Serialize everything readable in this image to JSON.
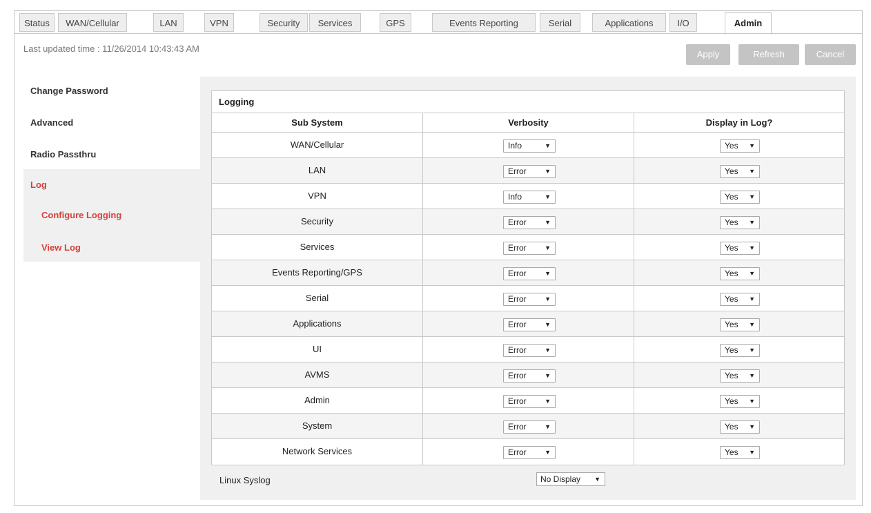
{
  "tabs": [
    "Status",
    "WAN/Cellular",
    "LAN",
    "VPN",
    "Security",
    "Services",
    "GPS",
    "Events Reporting",
    "Serial",
    "Applications",
    "I/O",
    "Admin"
  ],
  "active_tab": "Admin",
  "last_updated": "Last updated time : 11/26/2014 10:43:43 AM",
  "buttons": {
    "apply": "Apply",
    "refresh": "Refresh",
    "cancel": "Cancel"
  },
  "sidebar": {
    "change_password": "Change Password",
    "advanced": "Advanced",
    "radio_passthru": "Radio Passthru",
    "log": "Log",
    "configure_logging": "Configure Logging",
    "view_log": "View Log"
  },
  "logging": {
    "caption": "Logging",
    "headers": {
      "sub_system": "Sub System",
      "verbosity": "Verbosity",
      "display": "Display in Log?"
    },
    "rows": [
      {
        "sub_system": "WAN/Cellular",
        "verbosity": "Info",
        "display": "Yes"
      },
      {
        "sub_system": "LAN",
        "verbosity": "Error",
        "display": "Yes"
      },
      {
        "sub_system": "VPN",
        "verbosity": "Info",
        "display": "Yes"
      },
      {
        "sub_system": "Security",
        "verbosity": "Error",
        "display": "Yes"
      },
      {
        "sub_system": "Services",
        "verbosity": "Error",
        "display": "Yes"
      },
      {
        "sub_system": "Events Reporting/GPS",
        "verbosity": "Error",
        "display": "Yes"
      },
      {
        "sub_system": "Serial",
        "verbosity": "Error",
        "display": "Yes"
      },
      {
        "sub_system": "Applications",
        "verbosity": "Error",
        "display": "Yes"
      },
      {
        "sub_system": "UI",
        "verbosity": "Error",
        "display": "Yes"
      },
      {
        "sub_system": "AVMS",
        "verbosity": "Error",
        "display": "Yes"
      },
      {
        "sub_system": "Admin",
        "verbosity": "Error",
        "display": "Yes"
      },
      {
        "sub_system": "System",
        "verbosity": "Error",
        "display": "Yes"
      },
      {
        "sub_system": "Network Services",
        "verbosity": "Error",
        "display": "Yes"
      }
    ],
    "linux_syslog_label": "Linux Syslog",
    "linux_syslog_value": "No Display"
  },
  "colors": {
    "accent_red": "#d9403a",
    "button_gray": "#c4c4c4",
    "panel_bg": "#f0f0f0"
  }
}
